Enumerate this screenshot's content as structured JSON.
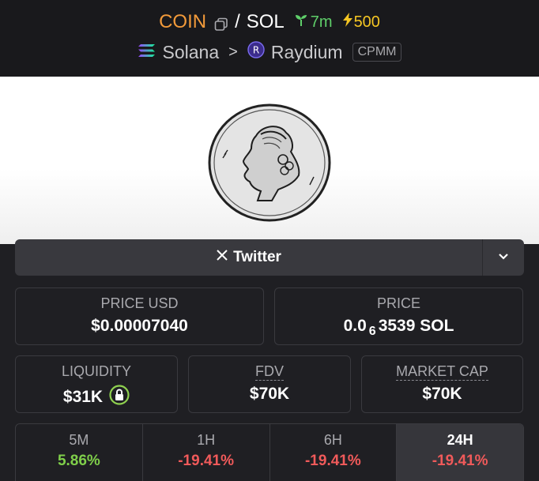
{
  "header": {
    "base": "COIN",
    "slash": "/",
    "quote": "SOL",
    "age": "7m",
    "boosts": "500",
    "chain": "Solana",
    "dex": "Raydium",
    "pool_type": "CPMM"
  },
  "twitter": {
    "label": "Twitter"
  },
  "stats": {
    "price_usd_label": "PRICE USD",
    "price_usd": "$0.00007040",
    "price_label": "PRICE",
    "price_prefix": "0.0",
    "price_zeros": "6",
    "price_rest": "3539 SOL",
    "liquidity_label": "LIQUIDITY",
    "liquidity": "$31K",
    "fdv_label": "FDV",
    "fdv": "$70K",
    "mcap_label": "MARKET CAP",
    "mcap": "$70K"
  },
  "changes": [
    {
      "period": "5M",
      "change": "5.86%"
    },
    {
      "period": "1H",
      "change": "-19.41%"
    },
    {
      "period": "6H",
      "change": "-19.41%"
    },
    {
      "period": "24H",
      "change": "-19.41%"
    }
  ],
  "colors": {
    "base": "#f29a3a",
    "positive": "#7fcf4a",
    "negative": "#f05a5a",
    "age": "#5fcf6a",
    "boost": "#f5c623"
  }
}
